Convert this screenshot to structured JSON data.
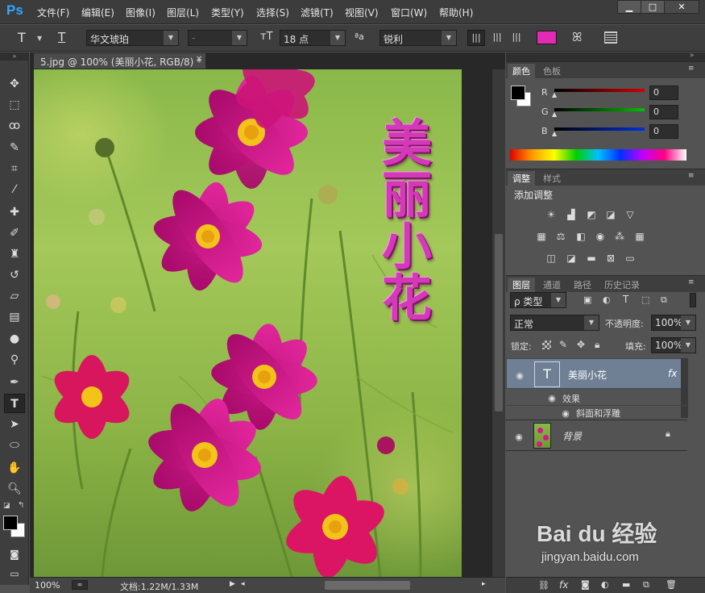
{
  "app": {
    "logo": "Ps"
  },
  "menu": [
    "文件(F)",
    "编辑(E)",
    "图像(I)",
    "图层(L)",
    "类型(Y)",
    "选择(S)",
    "滤镜(T)",
    "视图(V)",
    "窗口(W)",
    "帮助(H)"
  ],
  "window_controls": {
    "minimize": "▁",
    "maximize": "□",
    "close": "✕"
  },
  "options": {
    "tool_glyph": "T",
    "font_family": "华文琥珀",
    "font_style": "-",
    "font_size": "18 点",
    "antialias_icon": "ªa",
    "antialias": "锐利",
    "text_color": "#e12bb4"
  },
  "document": {
    "tab_title": "5.jpg @ 100% (美丽小花, RGB/8) *",
    "canvas_text": [
      "美",
      "丽",
      "小",
      "花"
    ],
    "zoom": "100%",
    "doc_info": "文档:1.22M/1.33M"
  },
  "color_panel": {
    "tabs": [
      "颜色",
      "色板"
    ],
    "channels": [
      {
        "label": "R",
        "value": "0",
        "color": "#d00000"
      },
      {
        "label": "G",
        "value": "0",
        "color": "#00c000"
      },
      {
        "label": "B",
        "value": "0",
        "color": "#0030e0"
      }
    ]
  },
  "adjust_panel": {
    "tabs": [
      "调整",
      "样式"
    ],
    "title": "添加调整"
  },
  "layers_panel": {
    "tabs": [
      "图层",
      "通道",
      "路径",
      "历史记录"
    ],
    "filter": "ρ 类型",
    "blend_mode": "正常",
    "opacity_label": "不透明度:",
    "opacity": "100%",
    "lock_label": "锁定:",
    "fill_label": "填充:",
    "fill": "100%",
    "layers": [
      {
        "name": "美丽小花",
        "fx": "fx",
        "effects_label": "效果",
        "effect": "斜面和浮雕"
      },
      {
        "name": "背景"
      }
    ]
  },
  "watermark": {
    "brand": "Bai du 经验",
    "url": "jingyan.baidu.com"
  }
}
